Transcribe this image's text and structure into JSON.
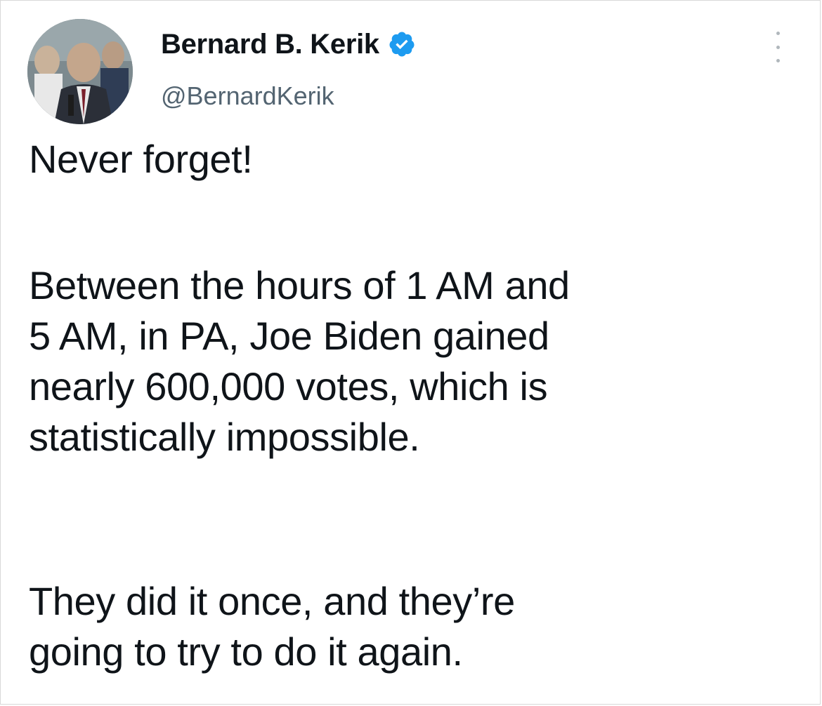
{
  "author": {
    "name": "Bernard B. Kerik",
    "handle": "@BernardKerik",
    "verified": true,
    "verified_color": "#1d9bf0"
  },
  "icons": {
    "verified": "verified-badge-icon",
    "more": "more-options-icon"
  },
  "tweet": {
    "paragraph_1": "Never forget!",
    "paragraph_2_lines": [
      "Between the hours of 1 AM and",
      "5 AM, in PA, Joe Biden gained",
      "nearly 600,000 votes, which is",
      "statistically impossible."
    ],
    "paragraph_3_lines": [
      "They did it once, and they’re",
      "going to try to do it again."
    ]
  },
  "colors": {
    "text": "#0f1419",
    "secondary_text": "#536471"
  }
}
